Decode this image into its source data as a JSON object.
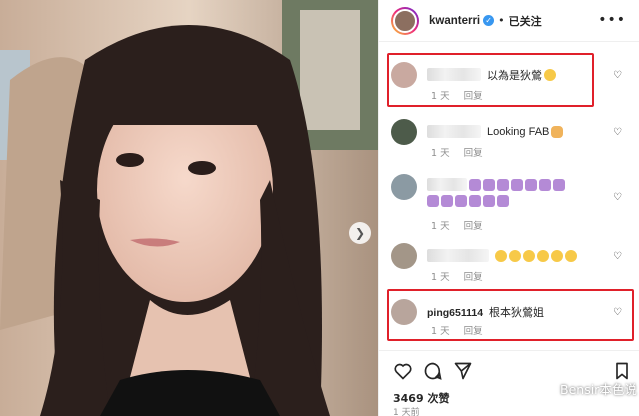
{
  "header": {
    "username": "kwanterri",
    "verified_badge": "✓",
    "separator": "•",
    "follow_status": "已关注",
    "more_icon": "more-horizontal-icon"
  },
  "photo": {
    "next_icon": "chevron-right-icon"
  },
  "comments": [
    {
      "text": "以為是狄鶯",
      "emoji": [
        "grin"
      ],
      "time": "1 天",
      "reply": "回复",
      "highlighted": true,
      "avatar_color": "#c9a9a0"
    },
    {
      "text": "Looking FAB",
      "emoji": [
        "clapping-hands"
      ],
      "time": "1 天",
      "reply": "回复",
      "highlighted": false,
      "avatar_color": "#4d5b4a"
    },
    {
      "text": "",
      "emoji": [
        "shield",
        "shield",
        "shield",
        "shield",
        "shield",
        "shield",
        "shield",
        "shield",
        "shield",
        "shield",
        "shield",
        "shield",
        "shield"
      ],
      "time": "1 天",
      "reply": "回复",
      "highlighted": false,
      "avatar_color": "#8b9aa3"
    },
    {
      "text": "",
      "emoji": [
        "heart-eyes",
        "heart-eyes",
        "heart-eyes",
        "heart-eyes",
        "heart-eyes",
        "heart-eyes"
      ],
      "time": "1 天",
      "reply": "回复",
      "highlighted": false,
      "avatar_color": "#a39688"
    },
    {
      "username": "ping651114",
      "text": "根本狄鶯姐",
      "time": "1 天",
      "reply": "回复",
      "highlighted": true,
      "avatar_color": "#b8a59c"
    }
  ],
  "actions": {
    "like_icon": "heart-icon",
    "comment_icon": "comment-icon",
    "share_icon": "send-icon",
    "save_icon": "bookmark-icon"
  },
  "likes_text": "3469 次赞",
  "post_time": "1 天前",
  "watermark": {
    "text": "Bensir本色说",
    "icon": "wechat-icon"
  },
  "colors": {
    "highlight": "#e0202a",
    "verified": "#3897f0",
    "meta_gray": "#8e8e8e"
  }
}
